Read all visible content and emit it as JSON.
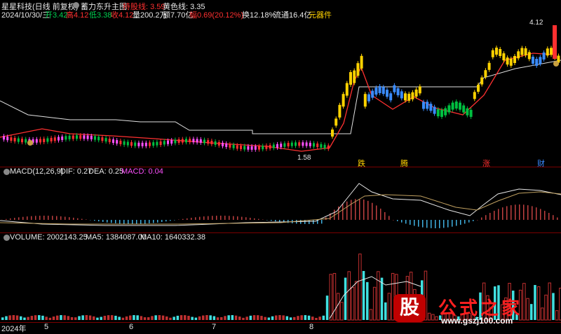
{
  "header": {
    "title": "星星科技(日线 前复权)",
    "indicator": "蓄力东升主图",
    "attack_line_label": "持股线: 3.59",
    "yellow_line_label": "黄色线: 3.35",
    "date": "2024/10/30/三",
    "open": "开3.42",
    "high": "高4.12",
    "low": "低3.38",
    "close": "收4.12",
    "volume": "量200.2万",
    "amount": "额7.70亿",
    "change": "幅0.69(20.12%)",
    "turnover": "换12.18%",
    "float_cap": "流通16.4亿",
    "sector": "元器件"
  },
  "price_panel": {
    "high_marker": "4.12",
    "low_marker": "1.58",
    "signals": [
      "跌",
      "腾",
      "涨",
      "财"
    ]
  },
  "macd": {
    "label": "MACD(12,26,9)",
    "dif": "DIF: 0.27",
    "dea": "DEA: 0.25",
    "macd": "MACD: 0.04"
  },
  "volume": {
    "label": "VOLUME: 2002143.25",
    "ma5": "MA5: 1384087.00",
    "ma10": "MA10: 1640332.38"
  },
  "x_axis": [
    "2024年",
    "5",
    "6",
    "7",
    "8"
  ],
  "watermark": {
    "logo": "股",
    "text": "公式之家",
    "url": "www.gszj100.com"
  },
  "colors": {
    "up": "#ff3030",
    "down": "#00c040",
    "yellow": "#ffd200",
    "blue": "#3a8bff",
    "magenta": "#ff50ff",
    "cyan": "#40e0e0"
  }
}
